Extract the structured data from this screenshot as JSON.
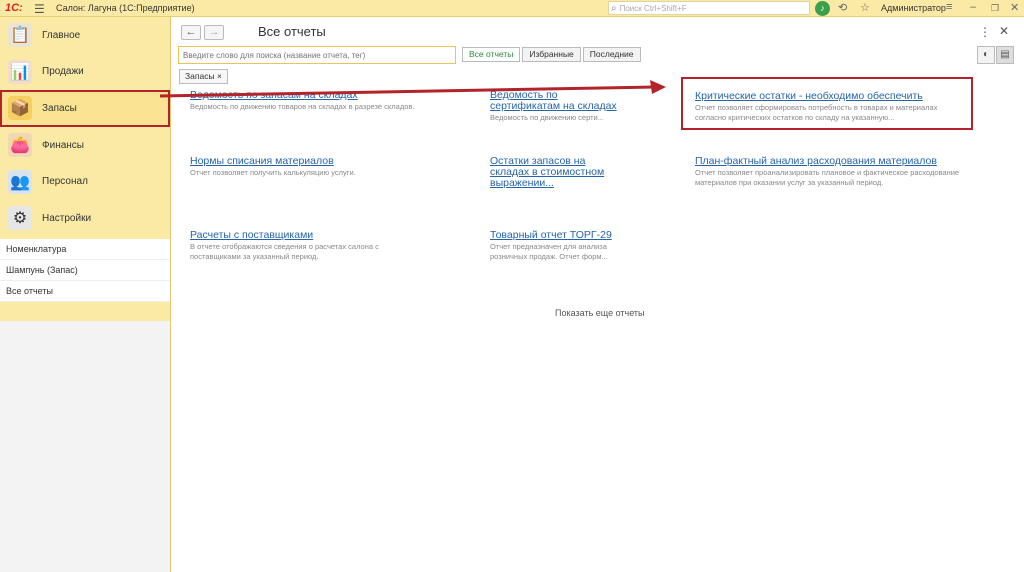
{
  "titlebar": {
    "logo": "1С:",
    "title": "Салон: Лагуна  (1С:Предприятие)",
    "search_placeholder": "Поиск Ctrl+Shift+F",
    "user": "Администратор"
  },
  "sidebar": {
    "sections": [
      {
        "label": "Главное",
        "icon": "clipboard-icon",
        "color": "#5a6a80",
        "glyph": "📋"
      },
      {
        "label": "Продажи",
        "icon": "bar-chart-icon",
        "color": "#c94f2a",
        "glyph": "📊"
      },
      {
        "label": "Запасы",
        "icon": "product-box-icon",
        "color": "#d8a21a",
        "glyph": "📦"
      },
      {
        "label": "Финансы",
        "icon": "wallet-icon",
        "color": "#b87332",
        "glyph": "👛"
      },
      {
        "label": "Персонал",
        "icon": "people-icon",
        "color": "#3d6ea8",
        "glyph": "👥"
      },
      {
        "label": "Настройки",
        "icon": "gear-icon",
        "color": "#666666",
        "glyph": "⚙"
      }
    ],
    "sub_items": [
      "Номенклатура",
      "Шампунь (Запас)",
      "Все отчеты"
    ]
  },
  "main": {
    "title": "Все отчеты",
    "search_placeholder": "Введите слово для поиска (название отчета, тег)",
    "tabs": [
      "Все отчеты",
      "Избранные",
      "Последние"
    ],
    "chip": "Запасы",
    "reports": [
      {
        "title": "Ведомость по запасам на складах",
        "desc": "Ведомость по движению товаров на складах в разрезе складов."
      },
      {
        "title": "Ведомость по сертификатам на складах",
        "desc": "Ведомость по движению серти..."
      },
      {
        "title": "Критические остатки - необходимо обеспечить",
        "desc": "Отчет позволяет сформировать потребность в товарах и материалах согласно критических остатков по складу на указанную..."
      },
      {
        "title": "Нормы списания материалов",
        "desc": "Отчет позволяет получить калькуляцию услуги."
      },
      {
        "title": "Остатки запасов на складах в стоимостном выражении...",
        "desc": ""
      },
      {
        "title": "План-фактный анализ расходования материалов",
        "desc": "Отчет позволяет проанализировать плановое и фактическое расходование материалов при оказании услуг за указанный период."
      },
      {
        "title": "Расчеты с поставщиками",
        "desc": "В отчете отображаются сведения о расчетах салона с поставщиками за указанный период."
      },
      {
        "title": "Товарный отчет ТОРГ-29",
        "desc": "Отчет предназначен для анализа розничных продаж. Отчет форм..."
      }
    ],
    "show_more": "Показать еще отчеты"
  },
  "colors": {
    "accent_red": "#b3242a",
    "link": "#2664a8",
    "sidebar_bg": "#fbeaa5"
  }
}
